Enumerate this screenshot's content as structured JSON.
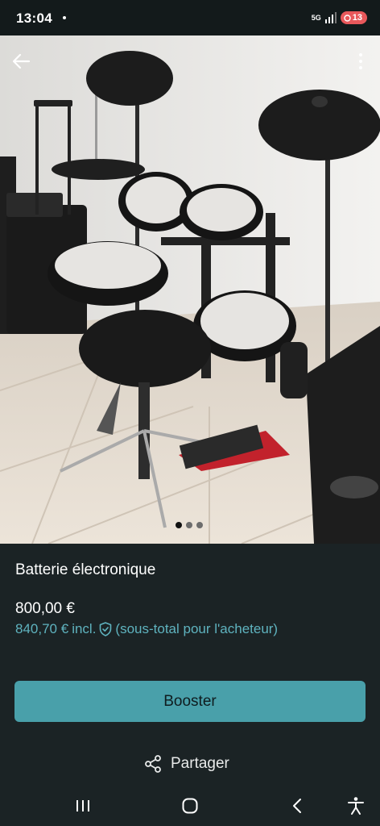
{
  "status_bar": {
    "time": "13:04",
    "network": "5G",
    "battery_level": "13",
    "battery_color": "#e8585b"
  },
  "listing": {
    "title": "Batterie électronique",
    "price": "800,00 €",
    "price_with_fees": "840,70 €",
    "incl_label": "incl.",
    "fees_note": "(sous-total pour l'acheteur)",
    "image_count": 3,
    "active_image_index": 0
  },
  "actions": {
    "boost_label": "Booster",
    "share_label": "Partager"
  },
  "icons": {
    "back": "arrow-left-icon",
    "more": "more-vertical-icon",
    "shield": "shield-check-icon",
    "share": "share-icon"
  },
  "colors": {
    "background": "#1b2325",
    "accent": "#49a0aa",
    "accent_text": "#5fb3bf"
  }
}
